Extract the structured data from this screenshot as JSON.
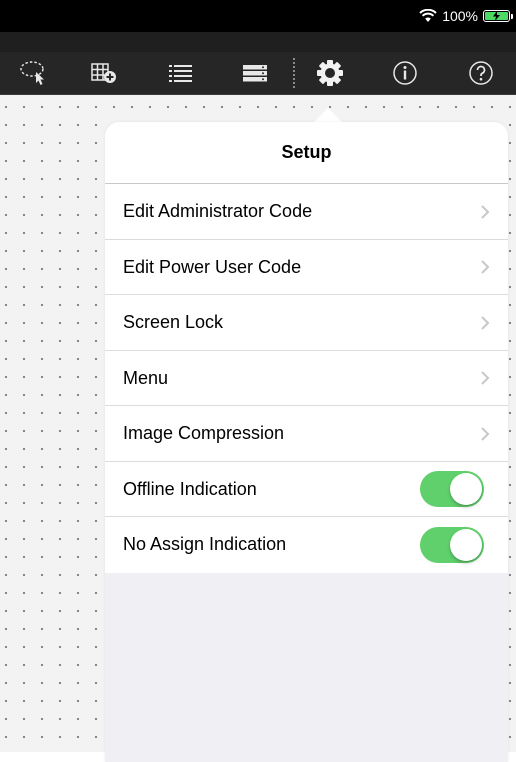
{
  "status_bar": {
    "battery_percent": "100%",
    "icons": [
      "wifi-icon",
      "battery-charging-icon"
    ]
  },
  "toolbar": {
    "buttons": [
      {
        "name": "lasso-select-button",
        "icon": "lasso-pointer-icon"
      },
      {
        "name": "add-table-button",
        "icon": "grid-plus-icon"
      },
      {
        "name": "list-view-button",
        "icon": "list-icon"
      },
      {
        "name": "storage-button",
        "icon": "server-stack-icon"
      },
      {
        "name": "setup-button",
        "icon": "gear-icon",
        "selected": true
      },
      {
        "name": "info-button",
        "icon": "info-icon"
      },
      {
        "name": "help-button",
        "icon": "question-icon"
      }
    ]
  },
  "setup": {
    "title": "Setup",
    "items": [
      {
        "label": "Edit Administrator Code",
        "type": "link"
      },
      {
        "label": "Edit Power User Code",
        "type": "link"
      },
      {
        "label": "Screen Lock",
        "type": "link"
      },
      {
        "label": "Menu",
        "type": "link"
      },
      {
        "label": "Image Compression",
        "type": "link"
      },
      {
        "label": "Offline Indication",
        "type": "toggle",
        "on": true
      },
      {
        "label": "No Assign Indication",
        "type": "toggle",
        "on": true
      }
    ]
  },
  "colors": {
    "toggle_on": "#5fd06b",
    "toolbar_bg": "#262626",
    "battery": "#4cd964"
  }
}
